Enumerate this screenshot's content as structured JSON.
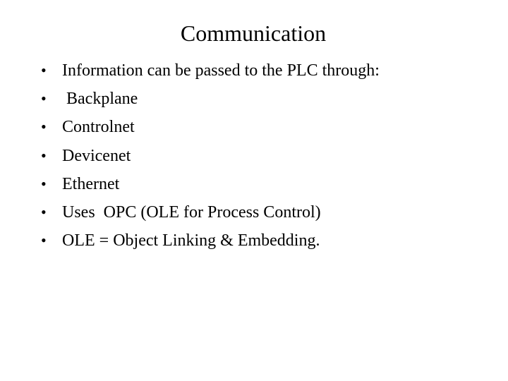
{
  "slide": {
    "title": "Communication",
    "bullet_glyph": "•",
    "bullets": [
      {
        "text": "Information can be passed to the PLC through:"
      },
      {
        "text": " Backplane"
      },
      {
        "text": "Controlnet"
      },
      {
        "text": "Devicenet"
      },
      {
        "text": "Ethernet"
      },
      {
        "text": "Uses  OPC (OLE for Process Control)"
      },
      {
        "text": "OLE = Object Linking & Embedding."
      }
    ]
  }
}
